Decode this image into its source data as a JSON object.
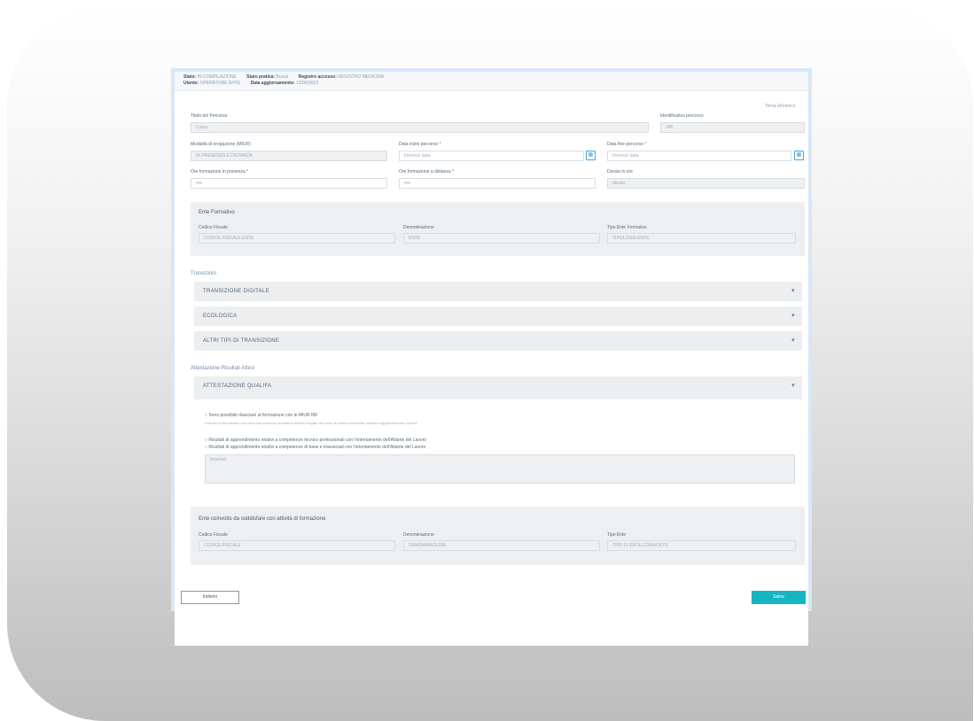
{
  "header": {
    "stato_key": "Stato:",
    "stato_val": "IN COMPILAZIONE",
    "stato_pratica_key": "Stato pratica:",
    "stato_pratica_val": "Bozza",
    "registro_key": "Registro accesso:",
    "registro_val": "REGISTRO MEDICINA",
    "utente_key": "Utente:",
    "utente_val": "OPERATORE ENTE",
    "data_key": "Data aggiornamento:",
    "data_val": "12/06/2023"
  },
  "top_link": "Torna all'elenco",
  "form": {
    "titolo_percorso": {
      "label": "Titolo del Percorso",
      "value": "Corso"
    },
    "identificativo": {
      "label": "Identificativo percorso",
      "value": "245"
    },
    "modalita": {
      "label": "Modalità di erogazione (MIUR)",
      "value": "IN PRESENZA E DISTANZA"
    },
    "data_inizio": {
      "label": "Data inizio percorso *",
      "placeholder": "Inserisci data"
    },
    "data_fine": {
      "label": "Data fine percorso *",
      "placeholder": "Inserisci data"
    },
    "ore_presenza": {
      "label": "Ore formazione in presenza *",
      "value": "ore"
    },
    "ore_distanza": {
      "label": "Ore formazione a distanza *",
      "value": "ore"
    },
    "durata": {
      "label": "Durata in ore",
      "value": "durata"
    }
  },
  "ente": {
    "title": "Ente Formativo",
    "cf": {
      "label": "Codice Fiscale",
      "value": "CODICE FISCALE ENTE"
    },
    "denominazione": {
      "label": "Denominazione",
      "value": "ENTE"
    },
    "tipo": {
      "label": "Tipo Ente Formativo",
      "value": "TIPOLOGIA ENTE"
    }
  },
  "transizioni_title": "Transizioni",
  "accordions": [
    {
      "label": "TRANSIZIONE DIGITALE"
    },
    {
      "label": "ECOLOGICA"
    },
    {
      "label": "ALTRI TIPI DI TRANSIZIONE"
    }
  ],
  "strategia_title": "Attestazione Risultati Attesi",
  "attestazione": {
    "label": "ATTESTAZIONE QUALIFA"
  },
  "checks": {
    "item1": "Sono possibile rilasciare al formazione con le MIUR IMI",
    "note1": "Indicare la formazione con corsi che potranno prevedere attività erogate dal corso al centro funzionale sanitario agganciamento coperte",
    "item2": "Risultati di apprendimento relativi a competenze tecnico professionali con l'orientamento dell'Atlante del Lavoro",
    "item3": "Risultati di apprendimento relativi a competenze di base e trasversali con l'orientamento dell'Atlante del Lavoro",
    "textarea": "Inserisci"
  },
  "ente_coinvolto": {
    "title": "Ente coinvolto da soddisfare con attività di formazione",
    "cf": {
      "label": "Codice Fiscale",
      "value": "CODICE FISCALE"
    },
    "denominazione": {
      "label": "Denominazione",
      "value": "DENOMINAZIONE"
    },
    "tipo": {
      "label": "Tipo Ente",
      "value": "TIPO DI ENTE COINVOLTO"
    }
  },
  "buttons": {
    "cancel": "Indietro",
    "save": "Salva"
  },
  "colors": {
    "accent": "#16b5c2",
    "link": "#4aa3d8",
    "window_bg": "#d7e8f7"
  }
}
